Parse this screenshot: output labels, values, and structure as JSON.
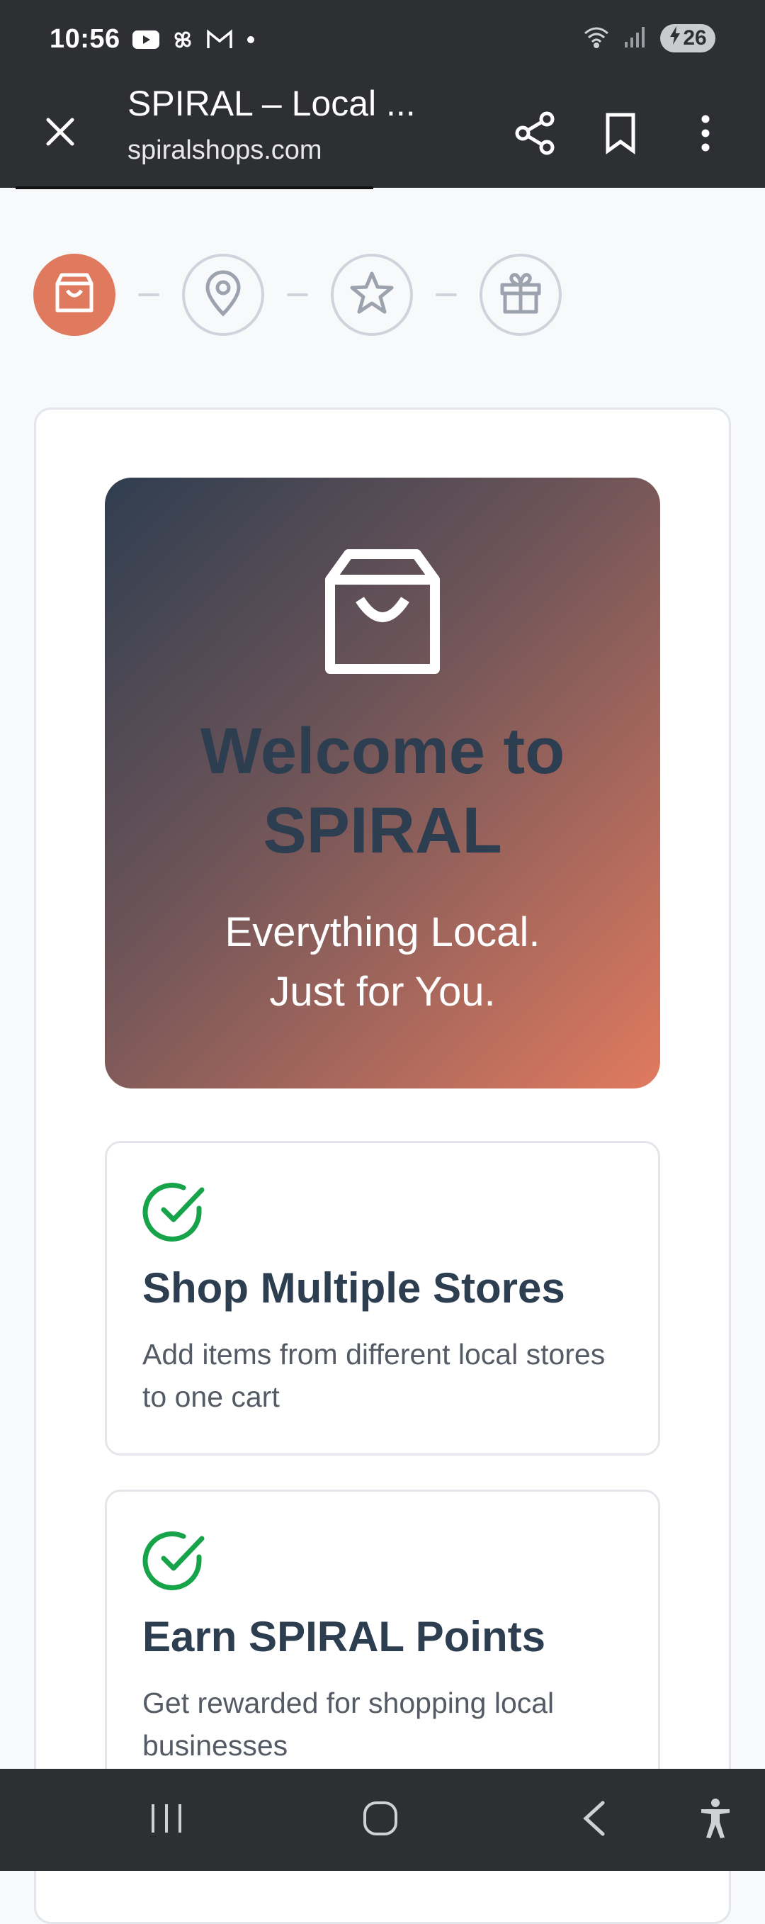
{
  "status_bar": {
    "time": "10:56",
    "battery": "26",
    "left_icons": [
      "youtube-icon",
      "pinwheel-icon",
      "gmail-icon",
      "notification-dot-icon"
    ],
    "right_icons": [
      "wifi-icon",
      "signal-icon",
      "battery-charging-icon"
    ]
  },
  "browser": {
    "title": "SPIRAL – Local ...",
    "url": "spiralshops.com",
    "actions": [
      "close-icon",
      "share-icon",
      "bookmark-icon",
      "more-options-icon"
    ]
  },
  "steps": {
    "icons": [
      "shopping-bag-icon",
      "location-pin-icon",
      "star-icon",
      "gift-icon"
    ],
    "active_index": 0
  },
  "hero": {
    "title_line1": "Welcome to",
    "title_line2": "SPIRAL",
    "subtitle_line1": "Everything Local.",
    "subtitle_line2": "Just for You."
  },
  "features": [
    {
      "title": "Shop Multiple Stores",
      "desc": "Add items from different local stores to one cart"
    },
    {
      "title": "Earn SPIRAL Points",
      "desc": "Get rewarded for shopping local businesses"
    }
  ],
  "colors": {
    "accent": "#e07a5f",
    "dark": "#2c3e50",
    "check": "#16a34a",
    "system_bar": "#2d2f33"
  }
}
